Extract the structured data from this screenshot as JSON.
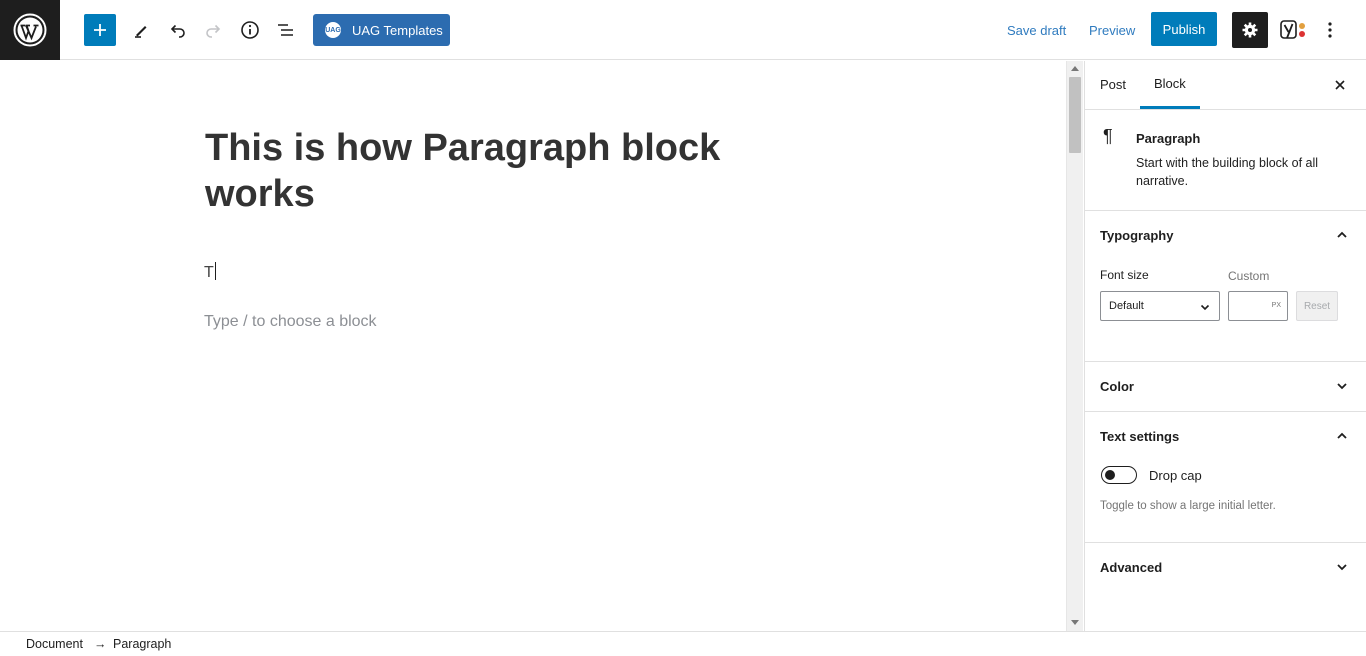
{
  "topbar": {
    "uag_badge": "UAG",
    "uag_label": "UAG Templates",
    "save_draft": "Save draft",
    "preview": "Preview",
    "publish": "Publish"
  },
  "editor": {
    "title": "This is how Paragraph block works",
    "paragraph_text": "T",
    "placeholder": "Type / to choose a block"
  },
  "sidebar": {
    "tabs": {
      "post": "Post",
      "block": "Block"
    },
    "block": {
      "name": "Paragraph",
      "description": "Start with the building block of all narrative."
    },
    "typography": {
      "title": "Typography",
      "font_size_label": "Font size",
      "custom_label": "Custom",
      "select_value": "Default",
      "unit": "PX",
      "reset": "Reset"
    },
    "color": {
      "title": "Color"
    },
    "text_settings": {
      "title": "Text settings",
      "drop_cap_label": "Drop cap",
      "help": "Toggle to show a large initial letter."
    },
    "advanced": {
      "title": "Advanced"
    }
  },
  "footer": {
    "crumbs": [
      "Document",
      "→",
      "Paragraph"
    ]
  },
  "colors": {
    "accent": "#007cba",
    "uag": "#2c6cb0",
    "dark": "#1e1e1e"
  }
}
